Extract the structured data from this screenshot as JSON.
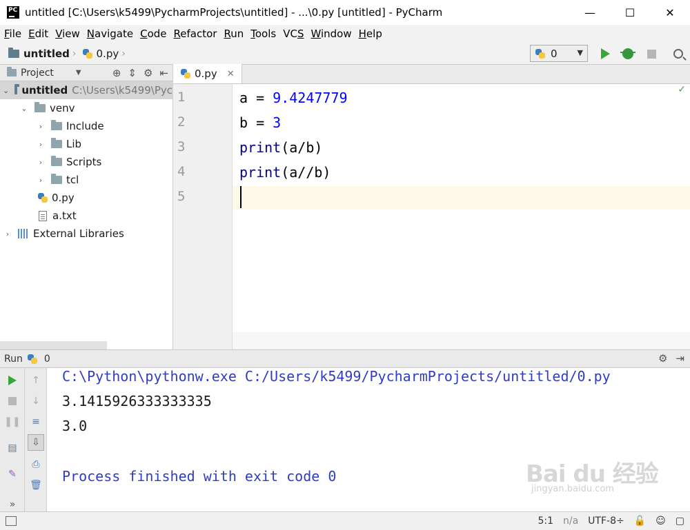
{
  "window": {
    "title": "untitled [C:\\Users\\k5499\\PycharmProjects\\untitled] - ...\\0.py [untitled] - PyCharm",
    "app_icon_label": "PC",
    "minimize": "—",
    "maximize": "☐",
    "close": "✕"
  },
  "menu": [
    {
      "label": "File",
      "mnemonic": "F",
      "rest": "ile"
    },
    {
      "label": "Edit",
      "mnemonic": "E",
      "rest": "dit"
    },
    {
      "label": "View",
      "mnemonic": "V",
      "rest": "iew"
    },
    {
      "label": "Navigate",
      "mnemonic": "N",
      "rest": "avigate"
    },
    {
      "label": "Code",
      "mnemonic": "C",
      "rest": "ode"
    },
    {
      "label": "Refactor",
      "mnemonic": "R",
      "rest": "efactor"
    },
    {
      "label": "Run",
      "mnemonic": "R",
      "rest": "un",
      "pre": ""
    },
    {
      "label": "Tools",
      "mnemonic": "T",
      "rest": "ools"
    },
    {
      "label": "VCS",
      "mnemonic": "S",
      "rest": "",
      "pre": "VC"
    },
    {
      "label": "Window",
      "mnemonic": "W",
      "rest": "indow"
    },
    {
      "label": "Help",
      "mnemonic": "H",
      "rest": "elp"
    }
  ],
  "breadcrumb": {
    "project": "untitled",
    "file": "0.py"
  },
  "run_config": {
    "selected": "0"
  },
  "project_panel": {
    "title": "Project",
    "tree": [
      {
        "label": "untitled",
        "path": "C:\\Users\\k5499\\Pyc"
      },
      {
        "label": "venv"
      },
      {
        "label": "Include"
      },
      {
        "label": "Lib"
      },
      {
        "label": "Scripts"
      },
      {
        "label": "tcl"
      },
      {
        "label": "0.py"
      },
      {
        "label": "a.txt"
      },
      {
        "label": "External Libraries"
      }
    ]
  },
  "editor": {
    "tab": "0.py",
    "line_numbers": [
      "1",
      "2",
      "3",
      "4",
      "5"
    ],
    "code": {
      "l1_var": "a",
      "l1_op": " = ",
      "l1_num": "9.4247779",
      "l2_var": "b",
      "l2_op": " = ",
      "l2_num": "3",
      "l3_fn": "print",
      "l3_args": "(a/b)",
      "l4_fn": "print",
      "l4_args": "(a//b)"
    }
  },
  "run_panel": {
    "title": "Run",
    "config": "0",
    "output": [
      "C:\\Python\\pythonw.exe C:/Users/k5499/PycharmProjects/untitled/0.py",
      "3.1415926333333335",
      "3.0",
      "Process finished with exit code 0"
    ]
  },
  "status": {
    "position": "5:1",
    "separator": "n/a",
    "encoding": "UTF-8÷"
  },
  "watermark": {
    "brand": "Bai du 经验",
    "url": "jingyan.baidu.com"
  }
}
